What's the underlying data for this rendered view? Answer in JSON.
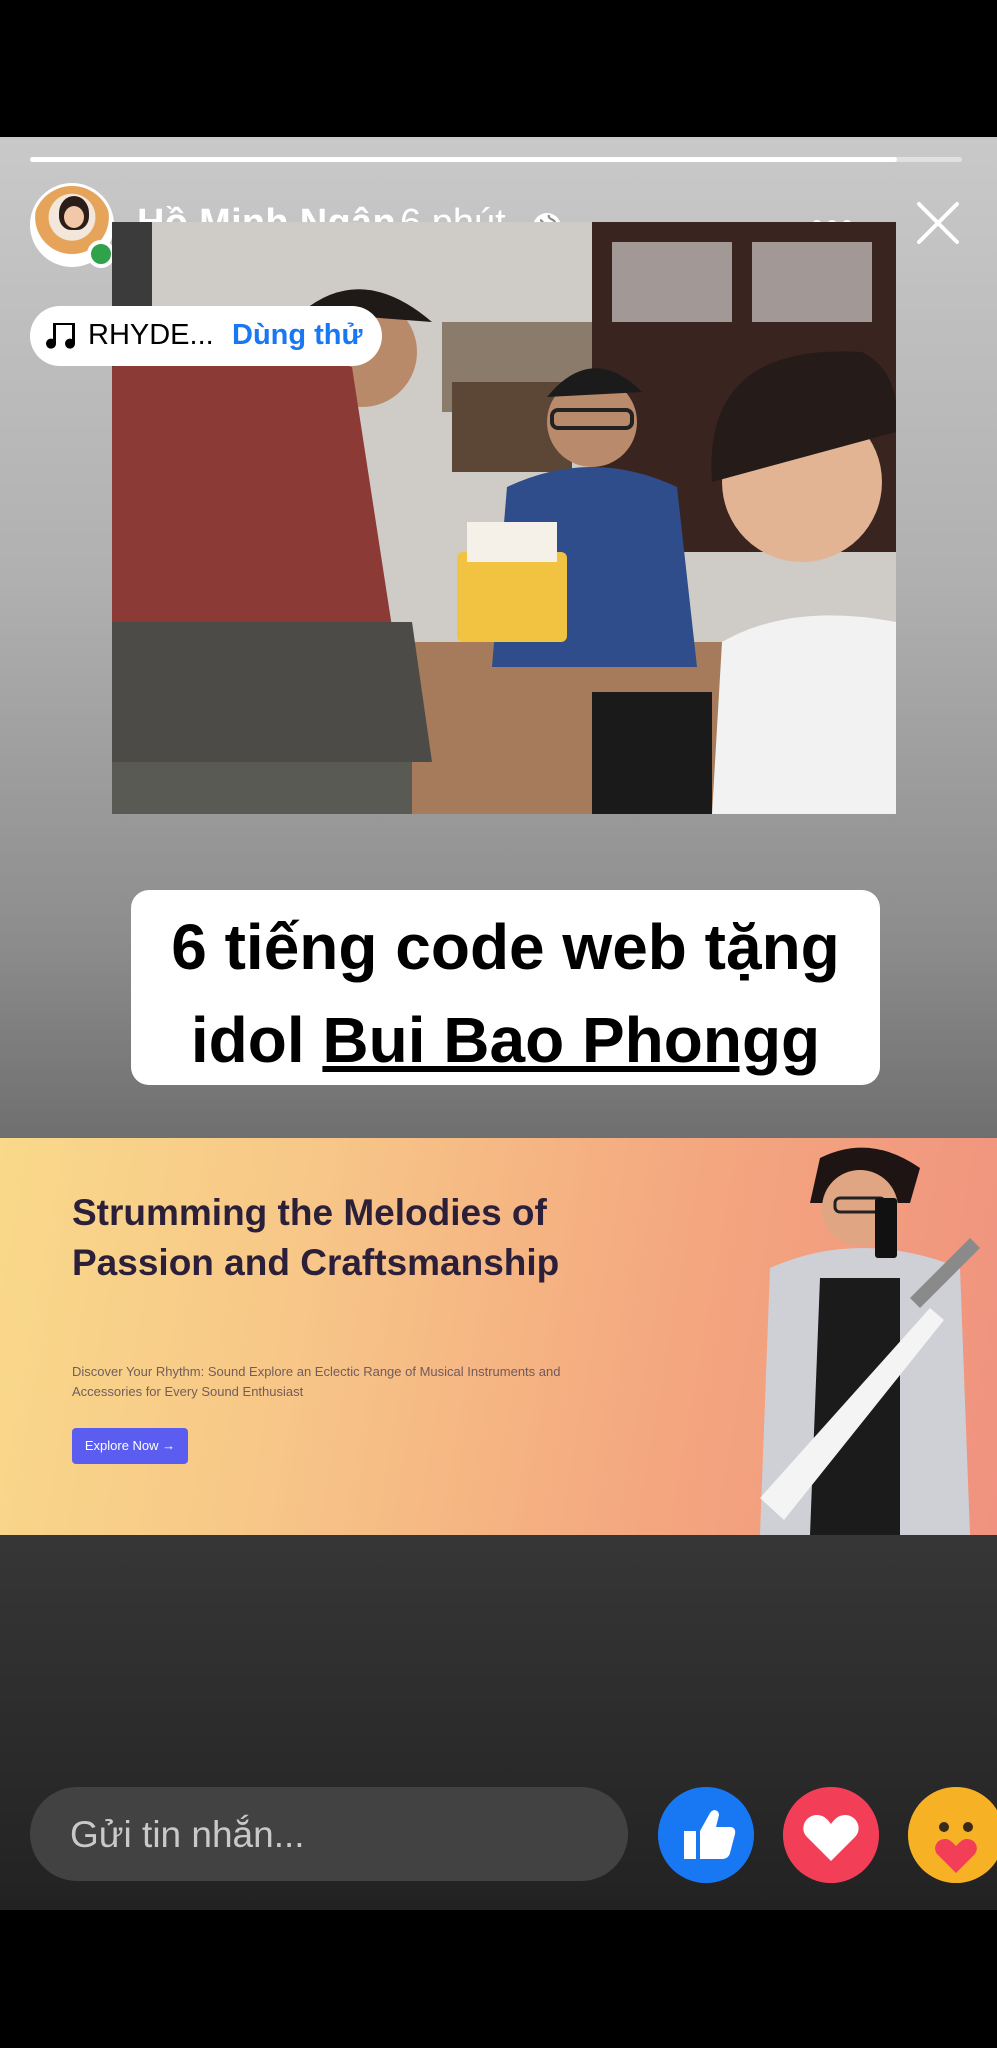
{
  "story": {
    "progress": 0.93,
    "author": {
      "name": "Hồ Minh Ngân",
      "time": "6 phút"
    },
    "music": {
      "title": "RHYDE...",
      "try_label": "Dùng thử"
    },
    "caption": {
      "line1": "6 tiếng code web tặng",
      "line2_prefix": "idol ",
      "line2_link": "Bui Bao Phongg"
    },
    "banner": {
      "title": "Strumming the Melodies of Passion and Craftsmanship",
      "description": "Discover Your Rhythm: Sound Explore an Eclectic Range of Musical Instruments and Accessories for Every Sound Enthusiast",
      "button_label": "Explore Now →"
    },
    "reply": {
      "placeholder": "Gửi tin nhắn..."
    },
    "reactions": [
      "like-icon",
      "love-icon",
      "care-icon"
    ],
    "colors": {
      "like": "#1877f2",
      "love": "#f33e58",
      "care": "#f7b125",
      "link": "#1877f2",
      "online": "#31a24c"
    }
  }
}
